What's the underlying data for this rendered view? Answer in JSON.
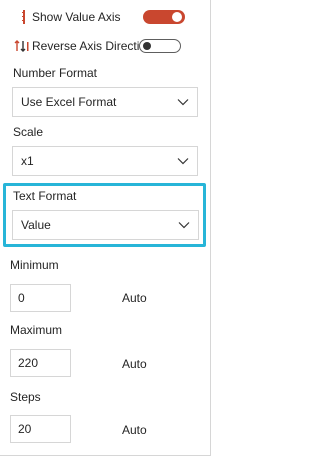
{
  "toggles": {
    "show_value_axis": {
      "label": "Show Value Axis",
      "state": "on",
      "icon": "value-axis-icon"
    },
    "reverse_axis": {
      "label": "Reverse Axis Direction",
      "state": "off",
      "icon": "reverse-axis-icon"
    }
  },
  "number_format": {
    "label": "Number Format",
    "value": "Use Excel Format"
  },
  "scale": {
    "label": "Scale",
    "value": "x1"
  },
  "text_format": {
    "label": "Text Format",
    "value": "Value"
  },
  "minimum": {
    "label": "Minimum",
    "value": "0",
    "auto_label": "Auto"
  },
  "maximum": {
    "label": "Maximum",
    "value": "220",
    "auto_label": "Auto"
  },
  "steps": {
    "label": "Steps",
    "value": "20",
    "auto_label": "Auto"
  },
  "colors": {
    "accent_toggle": "#c9472f",
    "highlight": "#27b5d8"
  }
}
